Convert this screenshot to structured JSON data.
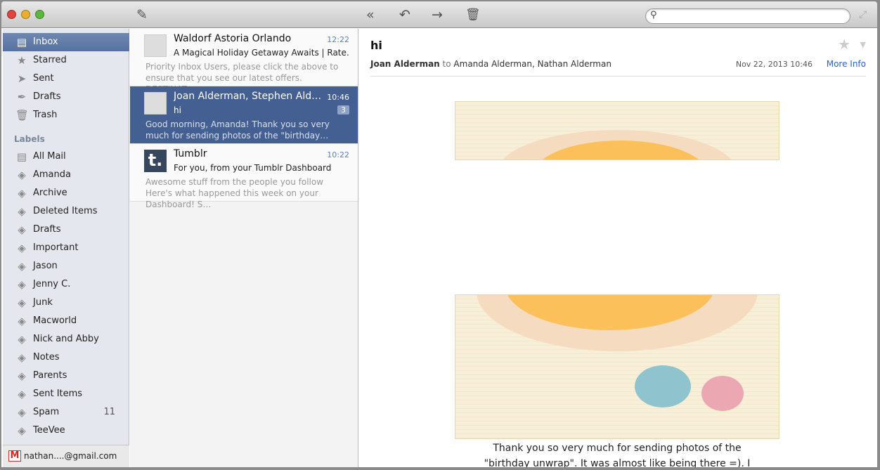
{
  "toolbar": {
    "compose_icon": "compose-icon",
    "actions": [
      "reply-all-icon",
      "reply-icon",
      "forward-icon",
      "trash-icon"
    ],
    "search_placeholder": ""
  },
  "sidebar": {
    "mailboxes": [
      {
        "label": "Inbox",
        "icon": "inbox-icon"
      },
      {
        "label": "Starred",
        "icon": "star-icon"
      },
      {
        "label": "Sent",
        "icon": "paper-plane-icon"
      },
      {
        "label": "Drafts",
        "icon": "quill-icon"
      },
      {
        "label": "Trash",
        "icon": "trash-icon"
      }
    ],
    "labels_heading": "Labels",
    "labels": [
      {
        "label": "All Mail"
      },
      {
        "label": "Amanda"
      },
      {
        "label": "Archive"
      },
      {
        "label": "Deleted Items"
      },
      {
        "label": "Drafts"
      },
      {
        "label": "Important"
      },
      {
        "label": "Jason"
      },
      {
        "label": "Jenny C."
      },
      {
        "label": "Junk"
      },
      {
        "label": "Macworld"
      },
      {
        "label": "Nick and Abby"
      },
      {
        "label": "Notes"
      },
      {
        "label": "Parents"
      },
      {
        "label": "Sent Items"
      },
      {
        "label": "Spam",
        "count": "11"
      },
      {
        "label": "TeeVee"
      }
    ],
    "account": "nathan....@gmail.com"
  },
  "messages": [
    {
      "from": "Waldorf Astoria Orlando",
      "time": "12:22",
      "subject": "A Magical Holiday Getaway Awaits | Rate…",
      "preview": "Priority Inbox Users, please click the above to ensure that you see our latest offers. DESTINAT…"
    },
    {
      "from": "Joan Alderman, Stephen Ald…",
      "time": "10:46",
      "subject": "hi",
      "count": "3",
      "preview": "Good morning, Amanda! Thank you so very much for sending photos of the \"birthday…"
    },
    {
      "from": "Tumblr",
      "time": "10:22",
      "subject": "For you, from your Tumblr Dashboard",
      "preview": "Awesome stuff from the people you follow Here's what happened this week on your Dashboard! S…",
      "avatar_letter": "t."
    }
  ],
  "reader": {
    "subject": "hi",
    "from": "Joan Alderman",
    "to_word": "to",
    "to": "Amanda Alderman, Nathan Alderman",
    "date": "Nov 22, 2013  10:46",
    "more_info": "More Info",
    "body_line1": "Thank you so very much for sending photos of the",
    "body_line2": "\"birthday unwrap\".  It was almost like being there =). I"
  }
}
